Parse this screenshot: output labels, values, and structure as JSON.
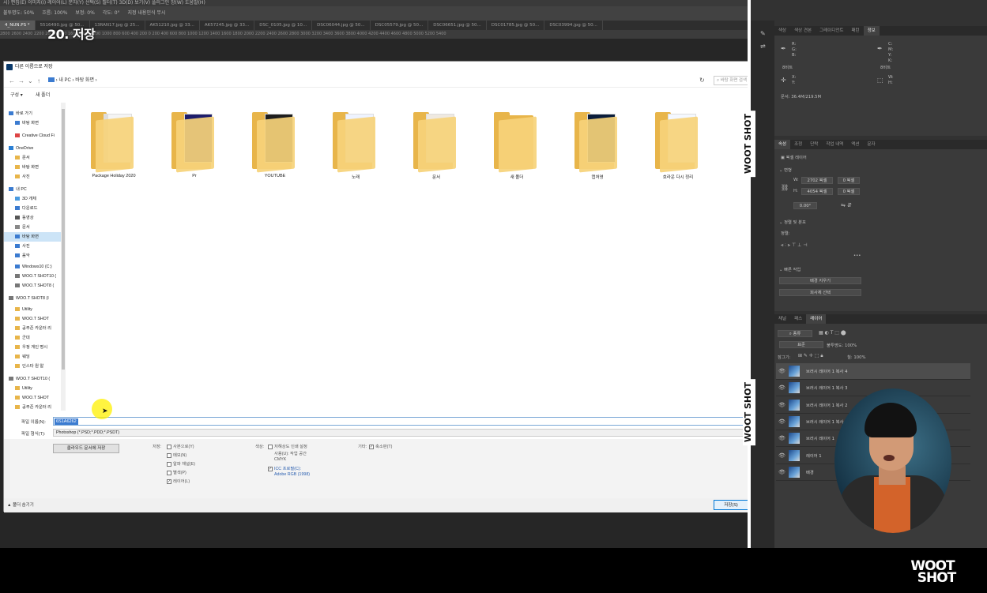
{
  "caption": "20. 저장",
  "menubar": "시)  편집(E)  이미지(I)  레이어(L)  문자(Y)  선택(S)  필터(T)  3D(D)  보기(V)  플러그인  창(W)  도움말(H)",
  "optbar": [
    "불투명도: 50%",
    "흐름: 100%",
    "보정: 0%",
    "각도: 0°"
  ],
  "optbar_hint": "지정 내용인식 무시",
  "tabs": [
    "4_NUN.PS *",
    "5516490.jpg @ 50...",
    "13RAN17.jpg @ 25...",
    "AK51210.jpg @ 33...",
    "AK57245.jpg @ 33...",
    "DSC_0105.jpg @ 10...",
    "DSC06044.jpg @ 50...",
    "DSC05579.jpg @ 50...",
    "DSC06651.jpg @ 50...",
    "DSC01785.jpg @ 50...",
    "DSC03994.jpg @ 50..."
  ],
  "ruler_text": "2800 2600 2400 2200 2000 1800 1600 1400 1200 1000 800 600 400 200 0 200 400 600 800 1000 1200 1400 1600 1800 2000 2200 2400 2600 2800 3000 3200 3400 3600 3800 4000 4200 4400 4600 4800 5000 5200 5400",
  "dialog": {
    "title": "다른 이름으로 저장",
    "path": [
      "내 PC",
      "바탕 화면"
    ],
    "search_placeholder": "바탕 화면 검색",
    "toolbar": {
      "organize": "구성 ▾",
      "new_folder": "새 폴더"
    },
    "nav": [
      {
        "label": "바로 가기",
        "icon": "star-icon",
        "color": "#3b7bd0"
      },
      {
        "label": "바탕 화면",
        "icon": "desktop-icon",
        "color": "#3b7bd0"
      },
      {
        "label": "Creative Cloud Fi",
        "icon": "cloud-icon",
        "color": "#d44"
      },
      {
        "label": "OneDrive",
        "icon": "cloud-icon",
        "color": "#2a7fd4"
      },
      {
        "label": "문서",
        "icon": "folder-icon",
        "color": "#e8b54a"
      },
      {
        "label": "바탕 화면",
        "icon": "folder-icon",
        "color": "#e8b54a"
      },
      {
        "label": "사진",
        "icon": "folder-icon",
        "color": "#e8b54a"
      },
      {
        "label": "내 PC",
        "icon": "pc-icon",
        "color": "#3b7bd0"
      },
      {
        "label": "3D 개체",
        "icon": "cube-icon",
        "color": "#4a9be0"
      },
      {
        "label": "다운로드",
        "icon": "download-icon",
        "color": "#3b7bd0"
      },
      {
        "label": "동영상",
        "icon": "video-icon",
        "color": "#555"
      },
      {
        "label": "문서",
        "icon": "document-icon",
        "color": "#888"
      },
      {
        "label": "바탕 화면",
        "icon": "desktop-icon",
        "color": "#3b7bd0"
      },
      {
        "label": "사진",
        "icon": "picture-icon",
        "color": "#3b7bd0"
      },
      {
        "label": "음악",
        "icon": "music-icon",
        "color": "#3b7bd0"
      },
      {
        "label": "Windows10 (C:)",
        "icon": "drive-icon",
        "color": "#3b7bd0"
      },
      {
        "label": "WOO.T SHOT10 (",
        "icon": "drive-icon",
        "color": "#777"
      },
      {
        "label": "WOO.T SHOT8 (",
        "icon": "drive-icon",
        "color": "#777"
      },
      {
        "label": "WOO.T SHOT8 (I",
        "icon": "drive-icon",
        "color": "#777"
      },
      {
        "label": "Utility",
        "icon": "folder-icon",
        "color": "#e8b54a"
      },
      {
        "label": "WOO.T SHOT",
        "icon": "folder-icon",
        "color": "#e8b54a"
      },
      {
        "label": "공주존 카운터 리",
        "icon": "folder-icon",
        "color": "#e8b54a"
      },
      {
        "label": "군대",
        "icon": "folder-icon",
        "color": "#e8b54a"
      },
      {
        "label": "우정 게인 명시 ",
        "icon": "folder-icon",
        "color": "#e8b54a"
      },
      {
        "label": "웨딩",
        "icon": "folder-icon",
        "color": "#e8b54a"
      },
      {
        "label": "인스타 원 알",
        "icon": "folder-icon",
        "color": "#e8b54a"
      },
      {
        "label": "WOO.T SHOT10 (",
        "icon": "drive-icon",
        "color": "#777"
      },
      {
        "label": "Utility",
        "icon": "folder-icon",
        "color": "#e8b54a"
      },
      {
        "label": "WOO.T SHOT",
        "icon": "folder-icon",
        "color": "#e8b54a"
      },
      {
        "label": "공주존 카운터 리",
        "icon": "folder-icon",
        "color": "#e8b54a"
      }
    ],
    "folders": [
      "Package Holiday 2020",
      "Pr",
      "YOUTUBE",
      "노래",
      "문서",
      "새 폴더",
      "캡처영",
      "호라운 다시 정리"
    ],
    "filename_label": "파일 이름(N):",
    "filename_value": "6S1A6262",
    "format_label": "파일 형식(T):",
    "format_value": "Photoshop (*.PSD;*.PDD;*.PSDT)",
    "cloud_button": "클라우드 문서에 저장",
    "save_label": "저장:",
    "save_opts": [
      {
        "label": "사본으로(Y)",
        "checked": false
      },
      {
        "label": "메모(N)",
        "checked": false
      },
      {
        "label": "알파 채널(E)",
        "checked": false
      },
      {
        "label": "별색(P)",
        "checked": false
      },
      {
        "label": "레이어(L)",
        "checked": true
      }
    ],
    "color_label": "색상:",
    "color_opts": [
      {
        "label": "저해상도 인쇄 설정",
        "checked": false
      },
      {
        "label": "사용(U): 작업 공간",
        "checked": false
      },
      {
        "label": "CMYK",
        "checked": false
      },
      {
        "label": "ICC 프로필(C):",
        "checked": true
      },
      {
        "label": "Adobe RGB (1998)",
        "checked": false
      }
    ],
    "other_label": "기타:",
    "other_opt": "축소판(T)",
    "hide_folders": "▲ 폴더 숨기기",
    "save_button": "저장(S)"
  },
  "right": {
    "top_tabs": [
      "색상",
      "색상 견본",
      "그레이디언트",
      "패턴",
      "정보"
    ],
    "info_letters": [
      "R:",
      "G:",
      "B:",
      "C:",
      "M:",
      "Y:",
      "K:",
      "X:",
      "Y:",
      "W:",
      "H:"
    ],
    "info_bits": [
      "8비트",
      "8비트"
    ],
    "doc_size": "문서: 36.4M/219.5M",
    "props_tabs": [
      "속성",
      "조정",
      "단락",
      "작업 내역",
      "액션",
      "문자"
    ],
    "pixel_layer": "픽셀 레이어",
    "transform": "변형",
    "w_label": "W:",
    "w_value": "2702 픽셀",
    "h_label": "H:",
    "h_value": "4054 픽셀",
    "x_value": "0 픽셀",
    "y_value": "0 픽셀",
    "angle": "0.00°",
    "align": "정렬 및 분포",
    "align_sub": "정렬:",
    "quick_actions": "빠른 작업",
    "quick_btn1": "배경 지우기",
    "quick_btn2": "피사체 선택",
    "layers_tabs": [
      "채널",
      "패스",
      "레이어"
    ],
    "kind": "종류",
    "blend": "표준",
    "opacity": "불투명도: 100%",
    "lock": "잠그기:",
    "fill": "칠: 100%",
    "layers": [
      "브러시 레이어 1 복사 4",
      "브러시 레이어 1 복사 3",
      "브러시 레이어 1 복사 2",
      "브러시 레이어 1 복사",
      "브러시 레이어 1",
      "레이어 1",
      "배경"
    ]
  },
  "watermark_vertical": "WOOT SHOT",
  "logo": {
    "line1": "WOOT",
    "line2": "SHOT"
  }
}
